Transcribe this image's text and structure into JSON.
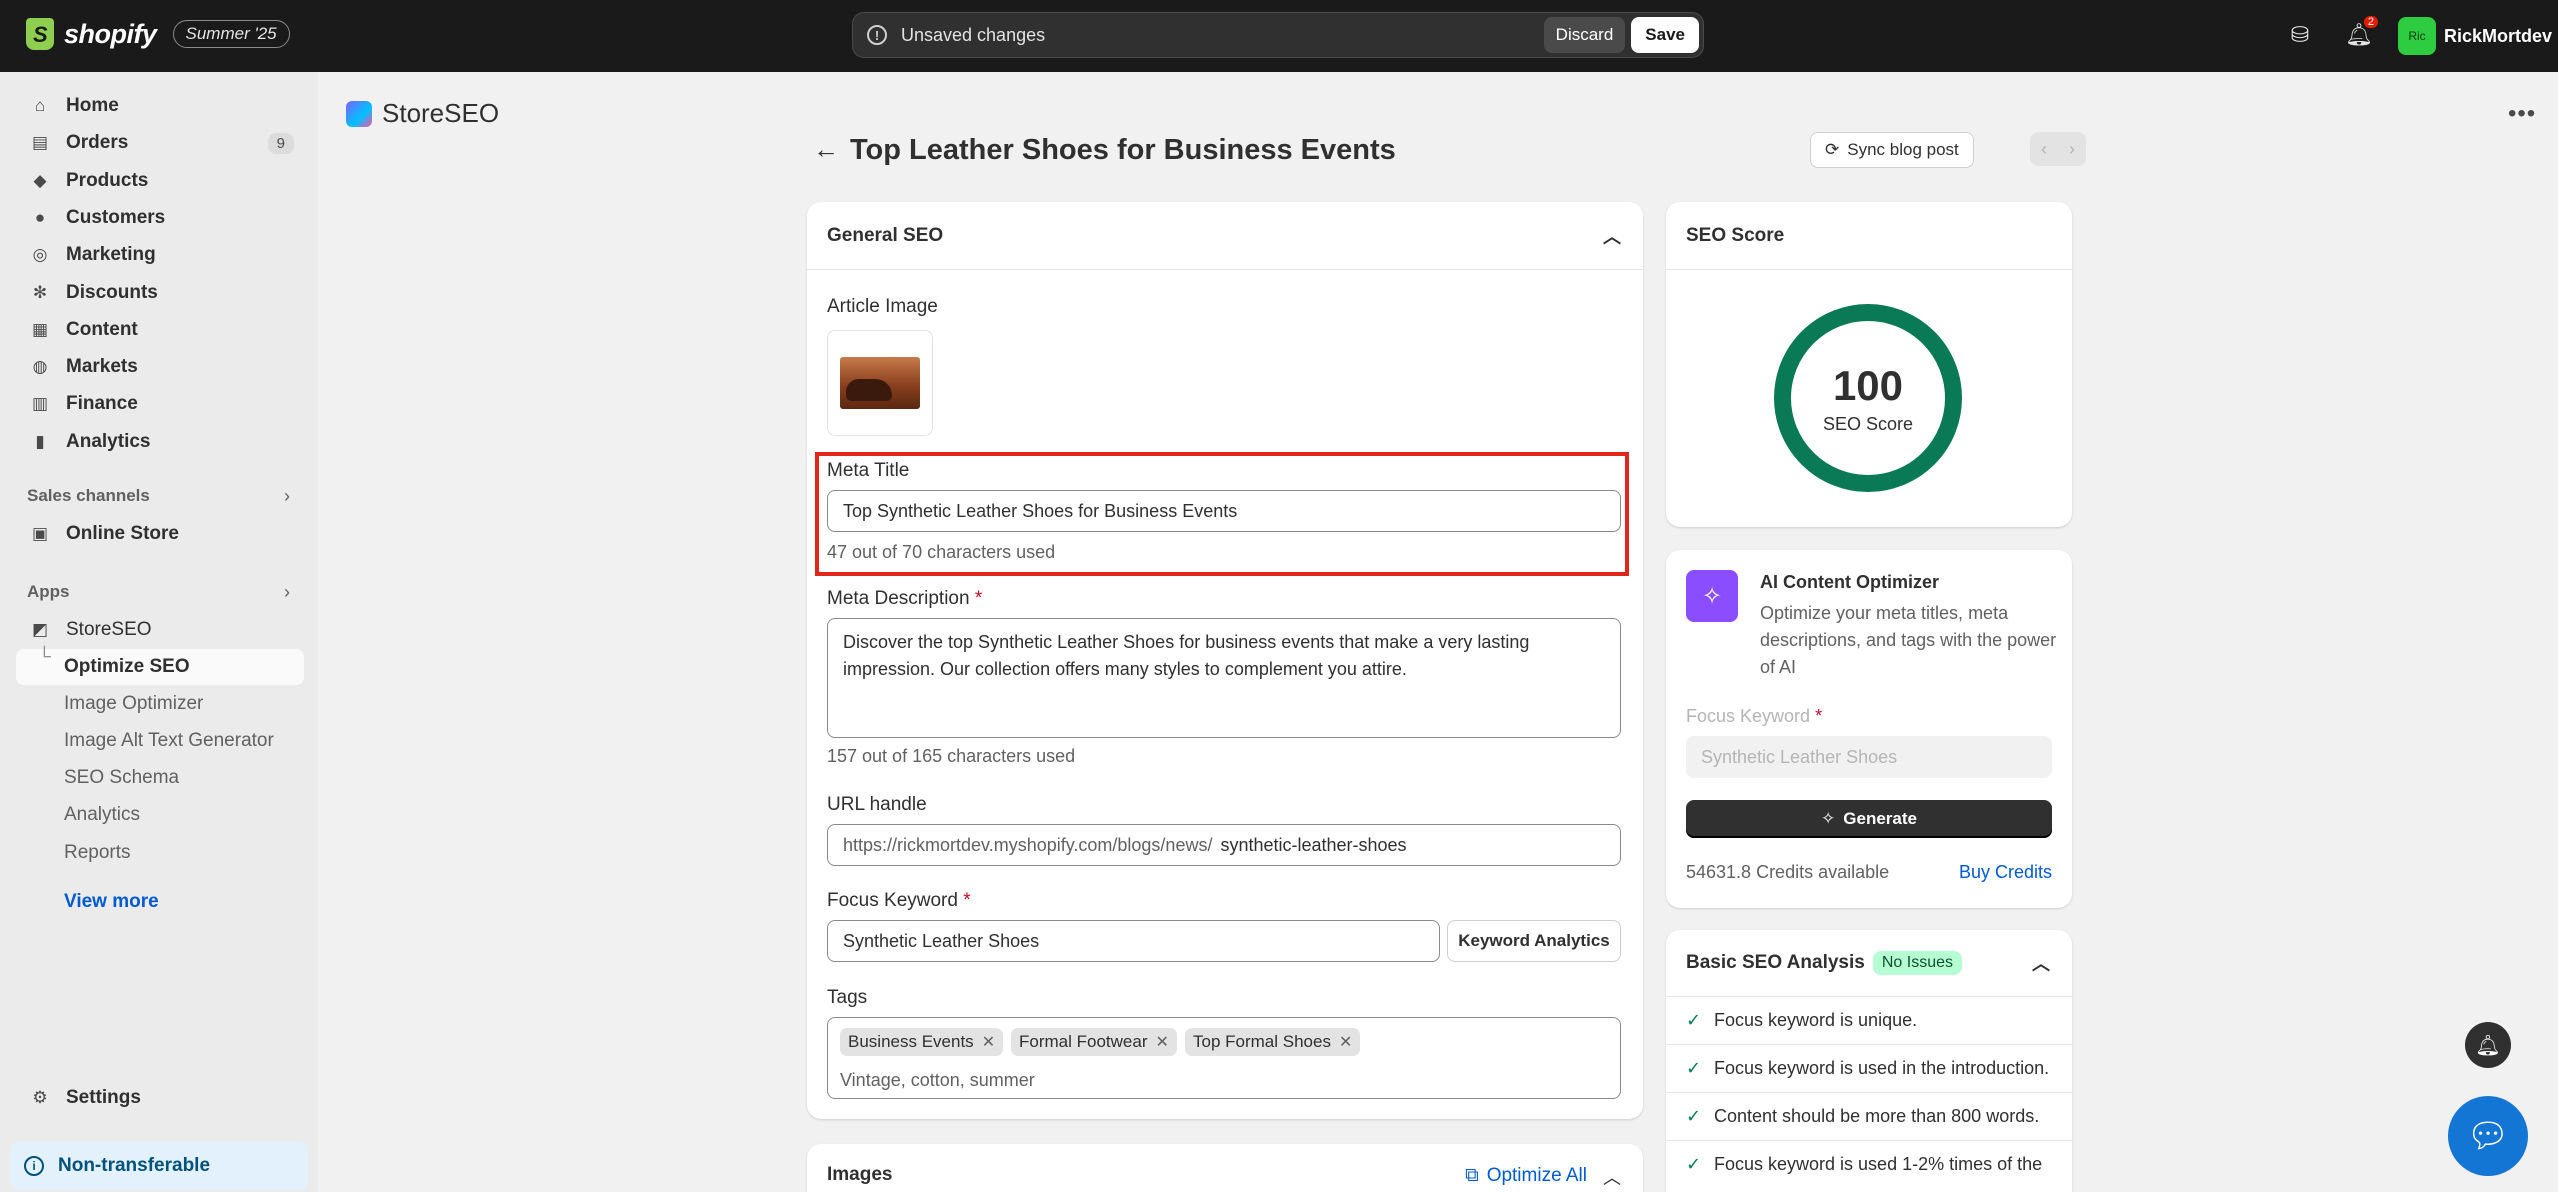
{
  "topbar": {
    "brand": "shopify",
    "edition": "Summer '25",
    "unsaved_text": "Unsaved changes",
    "discard_label": "Discard",
    "save_label": "Save",
    "notification_count": "2",
    "user_initials": "Ric",
    "user_name": "RickMortdev"
  },
  "sidebar": {
    "items": [
      {
        "label": "Home",
        "icon": "home-icon"
      },
      {
        "label": "Orders",
        "icon": "orders-icon",
        "count": "9"
      },
      {
        "label": "Products",
        "icon": "tag-icon"
      },
      {
        "label": "Customers",
        "icon": "person-icon"
      },
      {
        "label": "Marketing",
        "icon": "target-icon"
      },
      {
        "label": "Discounts",
        "icon": "discount-icon"
      },
      {
        "label": "Content",
        "icon": "content-icon"
      },
      {
        "label": "Markets",
        "icon": "globe-icon"
      },
      {
        "label": "Finance",
        "icon": "bank-icon"
      },
      {
        "label": "Analytics",
        "icon": "chart-icon"
      }
    ],
    "sales_channels_label": "Sales channels",
    "online_store_label": "Online Store",
    "apps_label": "Apps",
    "storeseo_label": "StoreSEO",
    "app_subitems": [
      "Optimize SEO",
      "Image Optimizer",
      "Image Alt Text Generator",
      "SEO Schema",
      "Analytics",
      "Reports"
    ],
    "view_more": "View more",
    "settings_label": "Settings",
    "non_transferable": "Non-transferable"
  },
  "app": {
    "title": "StoreSEO",
    "page_title": "Top Leather Shoes for Business Events",
    "sync_label": "Sync blog post"
  },
  "general_seo": {
    "header": "General SEO",
    "article_image_label": "Article Image",
    "meta_title_label": "Meta Title",
    "meta_title_value": "Top Synthetic Leather Shoes for Business Events",
    "meta_title_helper": "47 out of 70 characters used",
    "meta_desc_label": "Meta Description",
    "meta_desc_value": "Discover the top Synthetic Leather Shoes for business events that make a very lasting impression. Our collection offers many styles to complement you attire.",
    "meta_desc_helper": "157 out of 165 characters used",
    "url_label": "URL handle",
    "url_prefix": "https://rickmortdev.myshopify.com/blogs/news/",
    "url_value": "synthetic-leather-shoes",
    "focus_label": "Focus Keyword",
    "focus_value": "Synthetic Leather Shoes",
    "keyword_btn": "Keyword Analytics",
    "tags_label": "Tags",
    "tags": [
      "Business Events",
      "Formal Footwear",
      "Top Formal Shoes"
    ],
    "tags_placeholder": "Vintage, cotton, summer"
  },
  "images_card": {
    "header": "Images",
    "optimize_all": "Optimize All"
  },
  "seo_score": {
    "header": "SEO Score",
    "value": "100",
    "label": "SEO Score"
  },
  "ai": {
    "title": "AI Content Optimizer",
    "desc": "Optimize your meta titles, meta descriptions, and tags with the power of AI",
    "focus_label": "Focus Keyword",
    "focus_placeholder": "Synthetic Leather Shoes",
    "generate_label": "Generate",
    "credits": "54631.8 Credits available",
    "buy_label": "Buy Credits"
  },
  "basic_seo": {
    "header": "Basic SEO Analysis",
    "badge": "No Issues",
    "checks": [
      "Focus keyword is unique.",
      "Focus keyword is used in the introduction.",
      "Content should be more than 800 words.",
      "Focus keyword is used 1-2% times of the"
    ]
  },
  "colors": {
    "accent": "#005bd3",
    "score_ring": "#0a7a56",
    "highlight": "#e0261b",
    "ai_purple": "#8a4dff"
  }
}
